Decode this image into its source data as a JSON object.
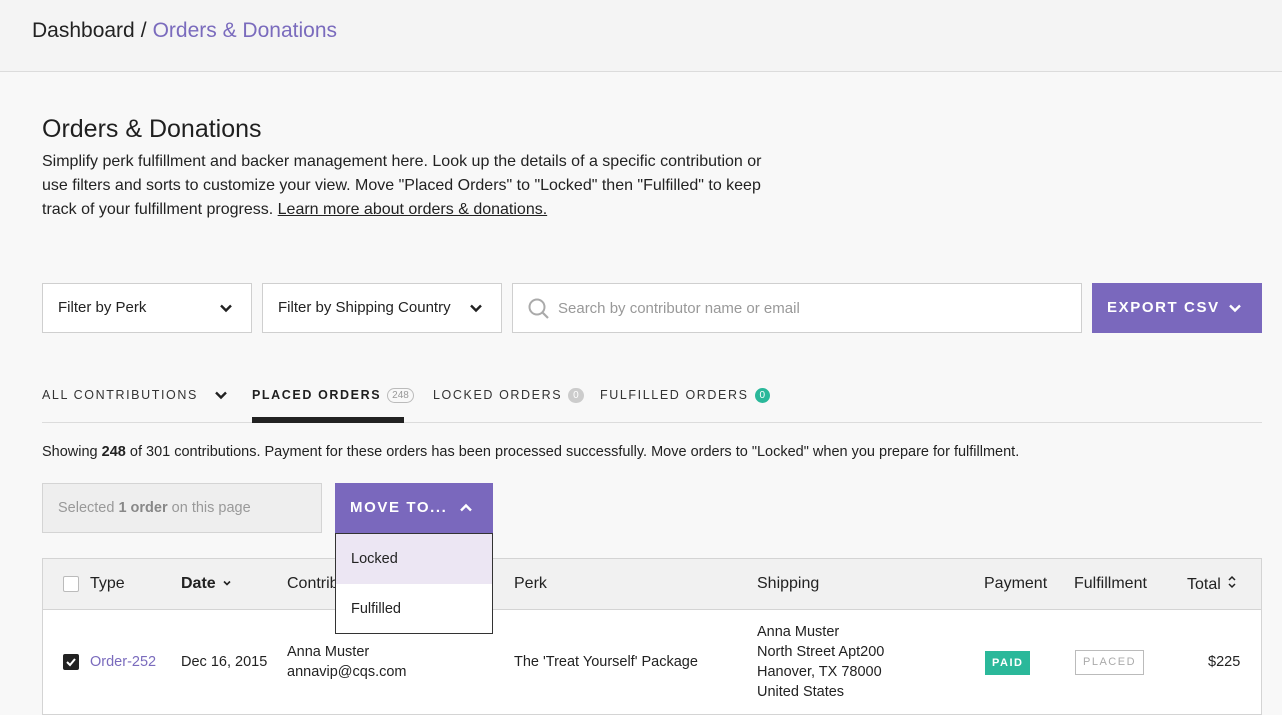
{
  "breadcrumb": {
    "root": "Dashboard",
    "separator": "/",
    "current": "Orders & Donations"
  },
  "page": {
    "title": "Orders & Donations",
    "description": "Simplify perk fulfillment and backer management here. Look up the details of a specific contribution or use filters and sorts to customize your view. Move \"Placed Orders\" to \"Locked\" then \"Fulfilled\" to keep track of your fulfillment progress.",
    "learn_more": "Learn more about orders & donations."
  },
  "filters": {
    "perk": "Filter by Perk",
    "country": "Filter by Shipping Country",
    "search_placeholder": "Search by contributor name or email",
    "export": "EXPORT CSV"
  },
  "tabs": [
    {
      "label": "ALL CONTRIBUTIONS",
      "count": ""
    },
    {
      "label": "PLACED ORDERS",
      "count": "248"
    },
    {
      "label": "LOCKED ORDERS",
      "count": "0"
    },
    {
      "label": "FULFILLED ORDERS",
      "count": "0"
    }
  ],
  "summary": {
    "prefix": "Showing",
    "shown": "248",
    "rest": "of 301 contributions. Payment for these orders has been processed successfully. Move orders to \"Locked\" when you prepare for fulfillment."
  },
  "selection": {
    "prefix": "Selected",
    "count": "1 order",
    "suffix": "on this page"
  },
  "move_to": {
    "label": "MOVE TO...",
    "options": [
      "Locked",
      "Fulfilled"
    ]
  },
  "table": {
    "headers": {
      "type": "Type",
      "date": "Date",
      "contributor": "Contributor",
      "perk": "Perk",
      "shipping": "Shipping",
      "payment": "Payment",
      "fulfillment": "Fulfillment",
      "total": "Total"
    },
    "rows": [
      {
        "type": "Order-252",
        "date": "Dec 16, 2015",
        "name": "Anna Muster",
        "email": "annavip@cqs.com",
        "perk": "The 'Treat Yourself' Package",
        "ship_name": "Anna Muster",
        "ship_street": "North Street Apt200",
        "ship_city": "Hanover, TX 78000",
        "ship_country": "United States",
        "payment": "PAID",
        "fulfillment": "PLACED",
        "total": "$225"
      }
    ]
  },
  "colors": {
    "accent": "#7a68bd",
    "link": "#7a6bbd",
    "success": "#2bb89a"
  }
}
